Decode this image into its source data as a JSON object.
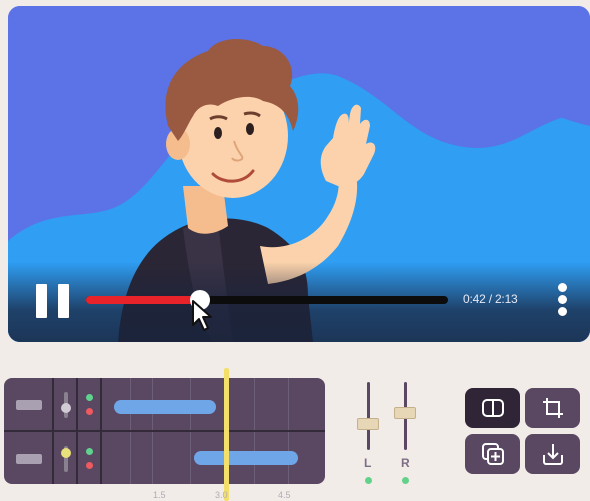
{
  "player": {
    "current_time": "0:42",
    "duration": "2:13",
    "time_display": "0:42 / 2:13",
    "progress_fraction": 0.316,
    "pause_icon": "pause-icon",
    "more_icon": "more-vertical-icon"
  },
  "timeline": {
    "tracks": [
      {
        "name": "track-1",
        "volume_fraction": 0.3,
        "knob_color": "#d0cbd4",
        "dots": [
          "#5fd38e",
          "#ee5a5f"
        ]
      },
      {
        "name": "track-2",
        "volume_fraction": 0.85,
        "knob_color": "#e8e07a",
        "dots": [
          "#5fd38e",
          "#ee5a5f"
        ]
      }
    ],
    "ticks": [
      "1.5",
      "3.0",
      "4.5"
    ],
    "clip_color": "#6ea6e8",
    "playhead_color": "#f2e06a"
  },
  "faders": {
    "left_label": "L",
    "right_label": "R",
    "left_level": 0.35,
    "right_level": 0.55
  },
  "tools": [
    {
      "name": "split-button",
      "icon": "split-icon",
      "active": true
    },
    {
      "name": "crop-button",
      "icon": "crop-icon",
      "active": false
    },
    {
      "name": "duplicate-button",
      "icon": "duplicate-add-icon",
      "active": false
    },
    {
      "name": "download-button",
      "icon": "download-icon",
      "active": false
    }
  ],
  "colors": {
    "progress": "#e8232a",
    "background": "#f2ece8",
    "panel": "#5a4862"
  }
}
